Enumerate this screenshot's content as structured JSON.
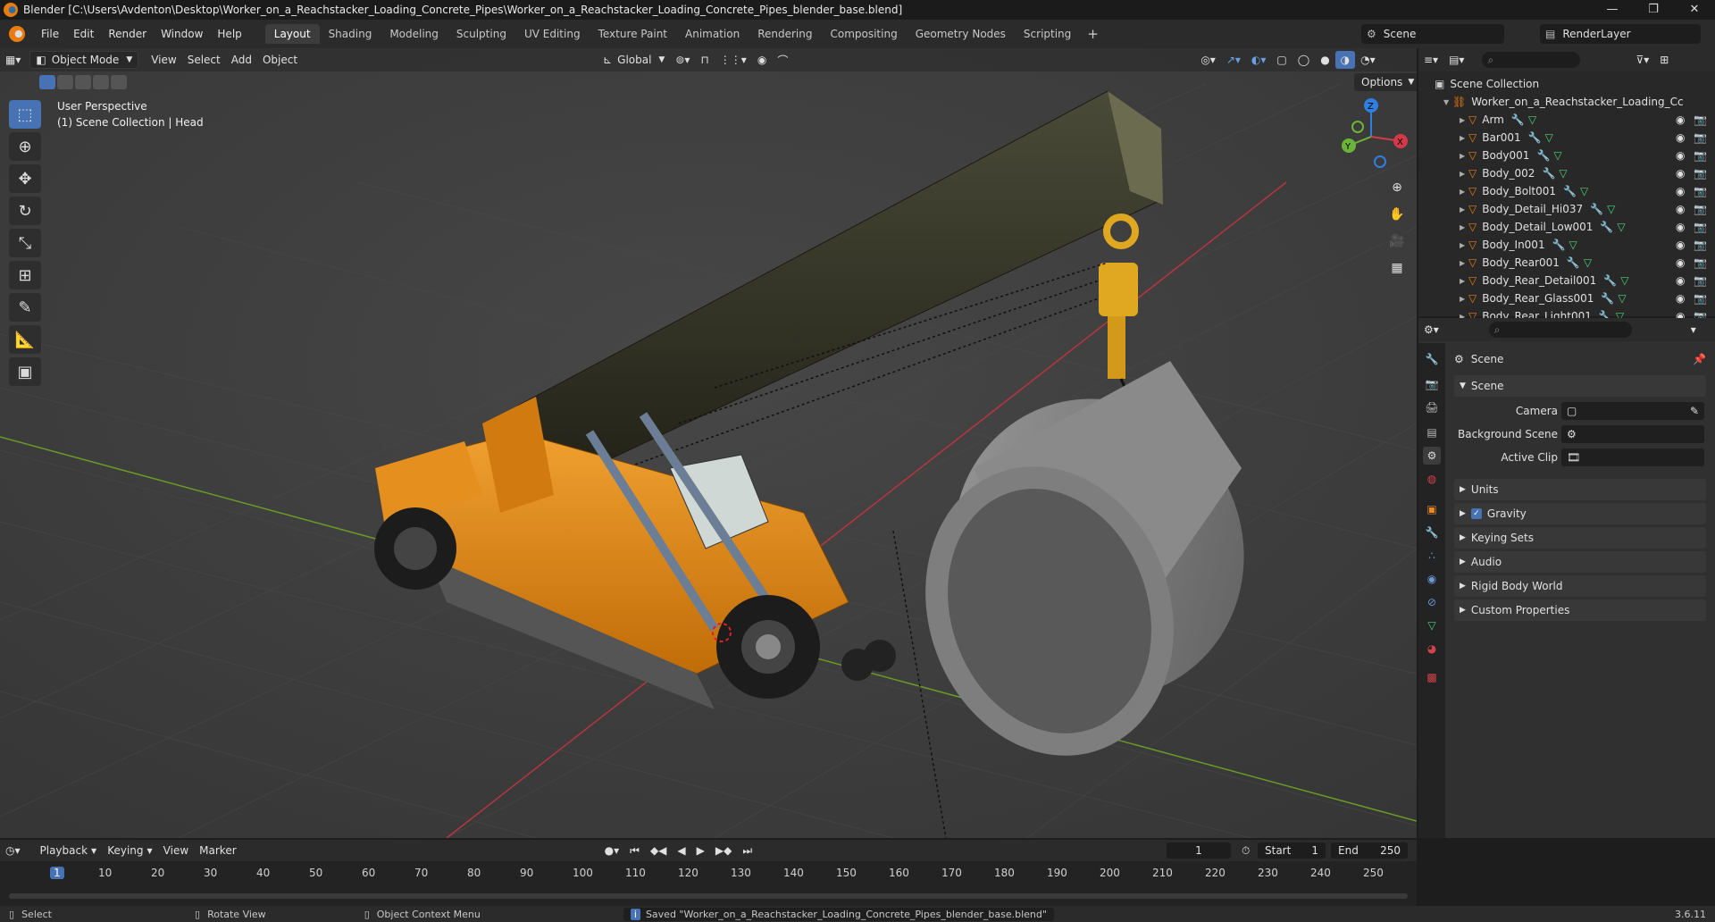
{
  "window": {
    "title": "Blender [C:\\Users\\Avdenton\\Desktop\\Worker_on_a_Reachstacker_Loading_Concrete_Pipes\\Worker_on_a_Reachstacker_Loading_Concrete_Pipes_blender_base.blend]",
    "minimize": "—",
    "maximize": "❐",
    "close": "✕"
  },
  "menu": {
    "items": [
      "File",
      "Edit",
      "Render",
      "Window",
      "Help"
    ],
    "workspaces": [
      "Layout",
      "Shading",
      "Modeling",
      "Sculpting",
      "UV Editing",
      "Texture Paint",
      "Animation",
      "Rendering",
      "Compositing",
      "Geometry Nodes",
      "Scripting"
    ],
    "active_workspace": "Layout",
    "add_workspace": "+",
    "scene": "Scene",
    "view_layer": "RenderLayer"
  },
  "viewport": {
    "mode": "Object Mode",
    "menus": [
      "View",
      "Select",
      "Add",
      "Object"
    ],
    "orientation": "Global",
    "options_label": "Options",
    "perspective": "User Perspective",
    "context": "(1) Scene Collection | Head",
    "gizmo": {
      "x": "X",
      "y": "Y",
      "z": "Z"
    }
  },
  "outliner": {
    "root": "Scene Collection",
    "collection": "Worker_on_a_Reachstacker_Loading_Cc",
    "objects": [
      "Arm",
      "Bar001",
      "Body001",
      "Body_002",
      "Body_Bolt001",
      "Body_Detail_Hi037",
      "Body_Detail_Low001",
      "Body_In001",
      "Body_Rear001",
      "Body_Rear_Detail001",
      "Body_Rear_Glass001",
      "Body_Rear_Light001"
    ]
  },
  "properties": {
    "header": "Scene",
    "panel_title": "Scene",
    "fields": [
      {
        "label": "Camera",
        "value": ""
      },
      {
        "label": "Background Scene",
        "value": ""
      },
      {
        "label": "Active Clip",
        "value": ""
      }
    ],
    "sections": [
      "Units",
      "Gravity",
      "Keying Sets",
      "Audio",
      "Rigid Body World",
      "Custom Properties"
    ],
    "gravity_checked": true
  },
  "timeline": {
    "menus": [
      "Playback",
      "Keying",
      "View",
      "Marker"
    ],
    "current_frame": "1",
    "start_label": "Start",
    "start": "1",
    "end_label": "End",
    "end": "250",
    "ticks": [
      "1",
      "10",
      "20",
      "30",
      "40",
      "50",
      "60",
      "70",
      "80",
      "90",
      "100",
      "110",
      "120",
      "130",
      "140",
      "150",
      "160",
      "170",
      "180",
      "190",
      "200",
      "210",
      "220",
      "230",
      "240",
      "250"
    ]
  },
  "status": {
    "select": "Select",
    "rotate": "Rotate View",
    "context_menu": "Object Context Menu",
    "message": "Saved \"Worker_on_a_Reachstacker_Loading_Concrete_Pipes_blender_base.blend\"",
    "version": "3.6.11"
  }
}
